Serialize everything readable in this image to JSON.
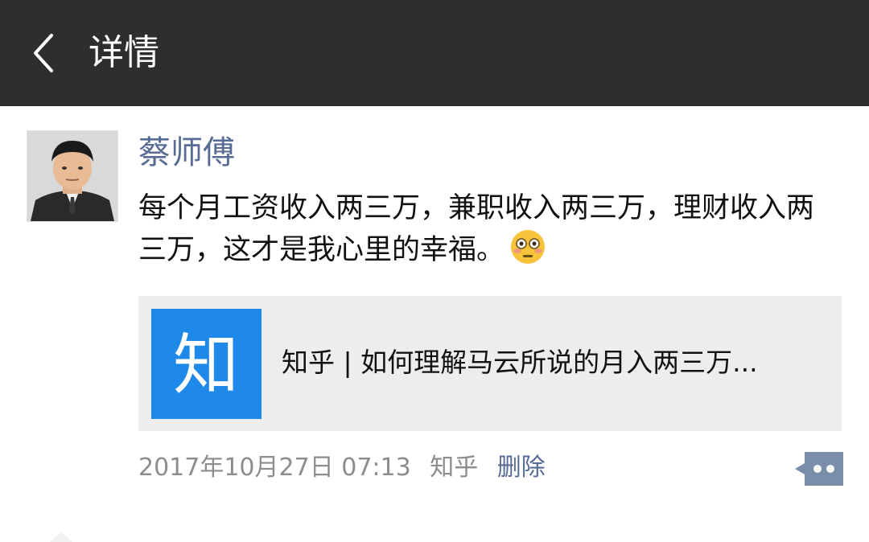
{
  "header": {
    "title": "详情",
    "back_icon": "chevron-left-icon"
  },
  "post": {
    "avatar_icon": "user-avatar",
    "username": "蔡师傅",
    "text": "每个月工资收入两三万，兼职收入两三万，理财收入两三万，这才是我心里的幸福。",
    "emoji": "flushed-face-emoji",
    "share": {
      "logo_text": "知",
      "title": "知乎 | 如何理解马云所说的月入两三万..."
    },
    "meta": {
      "time": "2017年10月27日 07:13",
      "source": "知乎",
      "delete_label": "删除"
    },
    "more_icon": "comment-more-icon"
  },
  "colors": {
    "topbar": "#2e2e2e",
    "link": "#576b95",
    "zhihu_blue": "#1e89e8",
    "card_bg": "#ededed"
  }
}
